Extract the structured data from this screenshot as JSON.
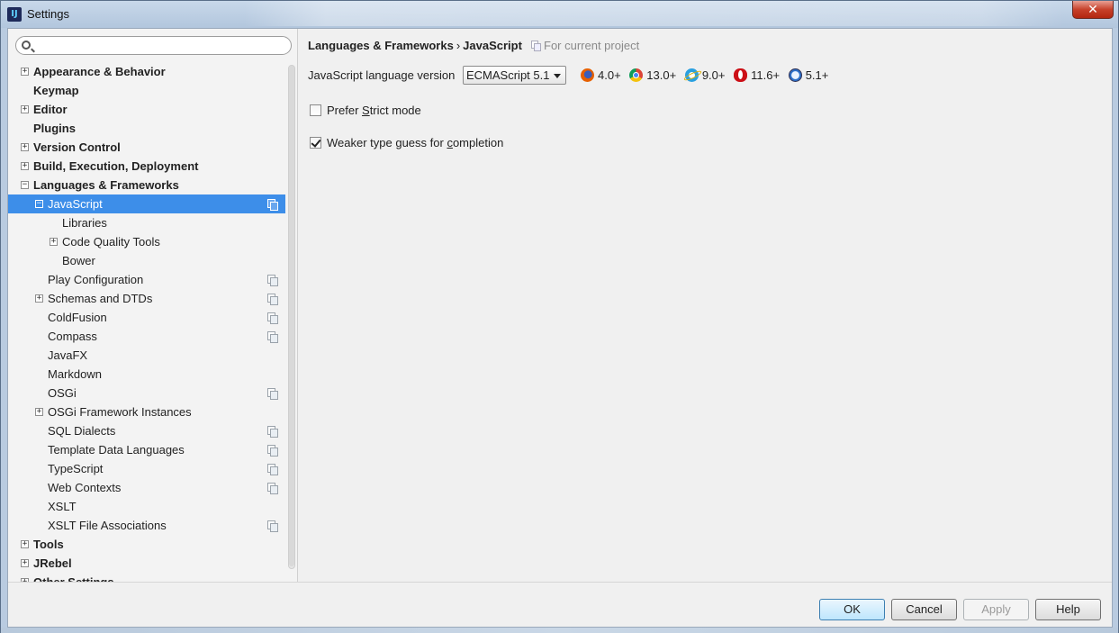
{
  "window": {
    "title": "Settings",
    "app_icon_text": "IJ",
    "close_glyph": "✕"
  },
  "search": {
    "placeholder": "",
    "value": ""
  },
  "tree": {
    "items": [
      {
        "label": "Appearance & Behavior",
        "level": 0,
        "expander": "+"
      },
      {
        "label": "Keymap",
        "level": 0,
        "expander": ""
      },
      {
        "label": "Editor",
        "level": 0,
        "expander": "+"
      },
      {
        "label": "Plugins",
        "level": 0,
        "expander": ""
      },
      {
        "label": "Version Control",
        "level": 0,
        "expander": "+"
      },
      {
        "label": "Build, Execution, Deployment",
        "level": 0,
        "expander": "+"
      },
      {
        "label": "Languages & Frameworks",
        "level": 0,
        "expander": "−"
      },
      {
        "label": "JavaScript",
        "level": 1,
        "expander": "−",
        "selected": true,
        "project_icon": true
      },
      {
        "label": "Libraries",
        "level": 2,
        "expander": ""
      },
      {
        "label": "Code Quality Tools",
        "level": 2,
        "expander": "+"
      },
      {
        "label": "Bower",
        "level": 2,
        "expander": ""
      },
      {
        "label": "Play Configuration",
        "level": 1,
        "expander": "",
        "project_icon": true
      },
      {
        "label": "Schemas and DTDs",
        "level": 1,
        "expander": "+",
        "project_icon": true
      },
      {
        "label": "ColdFusion",
        "level": 1,
        "expander": "",
        "project_icon": true
      },
      {
        "label": "Compass",
        "level": 1,
        "expander": "",
        "project_icon": true
      },
      {
        "label": "JavaFX",
        "level": 1,
        "expander": ""
      },
      {
        "label": "Markdown",
        "level": 1,
        "expander": ""
      },
      {
        "label": "OSGi",
        "level": 1,
        "expander": "",
        "project_icon": true
      },
      {
        "label": "OSGi Framework Instances",
        "level": 1,
        "expander": "+"
      },
      {
        "label": "SQL Dialects",
        "level": 1,
        "expander": "",
        "project_icon": true
      },
      {
        "label": "Template Data Languages",
        "level": 1,
        "expander": "",
        "project_icon": true
      },
      {
        "label": "TypeScript",
        "level": 1,
        "expander": "",
        "project_icon": true
      },
      {
        "label": "Web Contexts",
        "level": 1,
        "expander": "",
        "project_icon": true
      },
      {
        "label": "XSLT",
        "level": 1,
        "expander": ""
      },
      {
        "label": "XSLT File Associations",
        "level": 1,
        "expander": "",
        "project_icon": true
      },
      {
        "label": "Tools",
        "level": 0,
        "expander": "+"
      },
      {
        "label": "JRebel",
        "level": 0,
        "expander": "+"
      },
      {
        "label": "Other Settings",
        "level": 0,
        "expander": "+"
      }
    ]
  },
  "breadcrumb": {
    "parent": "Languages & Frameworks",
    "separator": "›",
    "current": "JavaScript",
    "scope_note": "For current project"
  },
  "language_version": {
    "label": "JavaScript language version",
    "selected": "ECMAScript 5.1"
  },
  "browsers": [
    {
      "icon": "firefox-icon",
      "version": "4.0+"
    },
    {
      "icon": "chrome-icon",
      "version": "13.0+"
    },
    {
      "icon": "ie-icon",
      "version": "9.0+"
    },
    {
      "icon": "opera-icon",
      "version": "11.6+"
    },
    {
      "icon": "safari-icon",
      "version": "5.1+"
    }
  ],
  "options": {
    "prefer_strict": {
      "label_pre": "Prefer ",
      "label_mnemonic": "S",
      "label_post": "trict mode",
      "checked": false
    },
    "weaker_type": {
      "label_pre": "Weaker type guess for ",
      "label_mnemonic": "c",
      "label_post": "ompletion",
      "checked": true
    }
  },
  "buttons": {
    "ok": "OK",
    "cancel": "Cancel",
    "apply": "Apply",
    "help": "Help"
  },
  "colors": {
    "selection": "#3d8ee9",
    "default_button": "#bee6fd"
  }
}
